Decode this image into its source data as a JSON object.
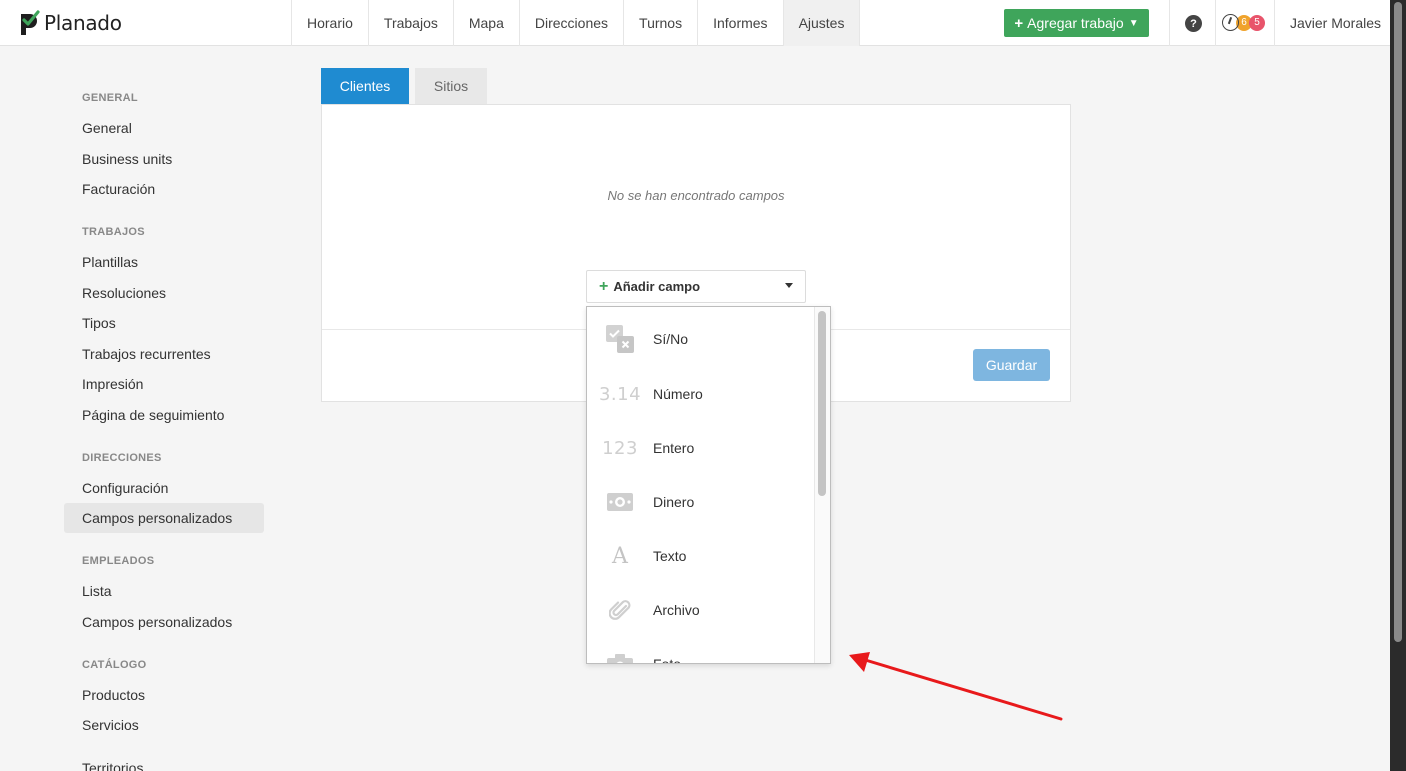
{
  "app": {
    "name": "Planado"
  },
  "nav": {
    "items": [
      {
        "label": "Horario"
      },
      {
        "label": "Trabajos"
      },
      {
        "label": "Mapa"
      },
      {
        "label": "Direcciones"
      },
      {
        "label": "Turnos"
      },
      {
        "label": "Informes"
      },
      {
        "label": "Ajustes",
        "active": true
      }
    ],
    "add_job_label": "Agregar trabajo",
    "help_glyph": "?",
    "badge_orange": "6",
    "badge_red": "5",
    "user_name": "Javier Morales"
  },
  "sidebar": {
    "sections": [
      {
        "title": "GENERAL",
        "items": [
          "General",
          "Business units",
          "Facturación"
        ]
      },
      {
        "title": "TRABAJOS",
        "items": [
          "Plantillas",
          "Resoluciones",
          "Tipos",
          "Trabajos recurrentes",
          "Impresión",
          "Página de seguimiento"
        ]
      },
      {
        "title": "DIRECCIONES",
        "items": [
          "Configuración",
          "Campos personalizados"
        ]
      },
      {
        "title": "EMPLEADOS",
        "items": [
          "Lista",
          "Campos personalizados"
        ]
      },
      {
        "title": "CATÁLOGO",
        "items": [
          "Productos",
          "Servicios"
        ]
      }
    ],
    "territorios": "Territorios"
  },
  "tabs": {
    "clientes": "Clientes",
    "sitios": "Sitios"
  },
  "panel": {
    "empty_message": "No se han encontrado campos",
    "add_field_label": "Añadir campo",
    "save_label": "Guardar"
  },
  "dropdown": {
    "items": [
      {
        "label": "Sí/No",
        "icon": "checkbox-icon"
      },
      {
        "label": "Número",
        "icon": "decimal-number-icon",
        "glyph": "3.14"
      },
      {
        "label": "Entero",
        "icon": "integer-icon",
        "glyph": "123"
      },
      {
        "label": "Dinero",
        "icon": "money-icon"
      },
      {
        "label": "Texto",
        "icon": "text-icon",
        "glyph": "A"
      },
      {
        "label": "Archivo",
        "icon": "paperclip-icon"
      },
      {
        "label": "Foto",
        "icon": "camera-icon"
      }
    ]
  },
  "colors": {
    "brand_green": "#3fa55b",
    "active_tab_blue": "#1f8bd1",
    "save_button": "#7eb6e0",
    "annotation_arrow": "#e8191b"
  }
}
